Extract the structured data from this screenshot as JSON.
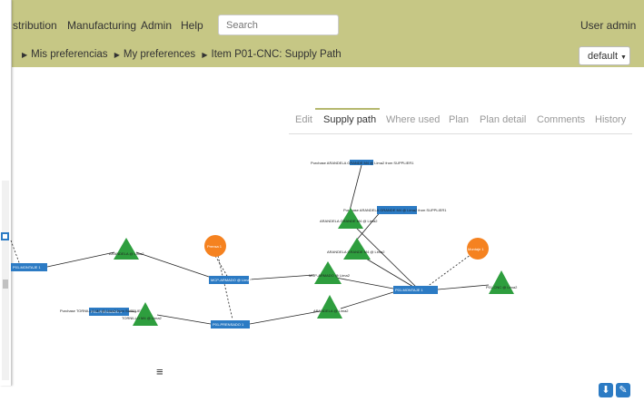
{
  "menu": {
    "distribution": "stribution",
    "manufacturing": "Manufacturing",
    "admin": "Admin",
    "help": "Help",
    "user": "User admin"
  },
  "search": {
    "placeholder": "Search"
  },
  "breadcrumb": {
    "items": [
      "Mis preferencias",
      "My preferences",
      "Item P01-CNC: Supply Path"
    ]
  },
  "scenario": {
    "label": "default"
  },
  "tabs": [
    "Edit",
    "Supply path",
    "Where used",
    "Plan",
    "Plan detail",
    "Comments",
    "History"
  ],
  "active_tab": "Supply path",
  "graph": {
    "colors": {
      "buffer": "#2c7bc4",
      "operation": "#2e9e3e",
      "resource": "#f58220",
      "edge": "#222222"
    },
    "nodes": [
      {
        "label": "Purchase ARANDELA GRANDE M4 @ Lima2 from SUPPLIER1",
        "kind": "buffer"
      },
      {
        "label": "Purchase ARANDELA GRANDE M4 @ Lima2 from SUPPLIER1",
        "kind": "buffer"
      },
      {
        "label": "ARANDELA GRANDE M4 @ Lima2",
        "kind": "operation"
      },
      {
        "label": "ARANDELA GRANDE M4 @ Lima2",
        "kind": "operation"
      },
      {
        "label": "Montaje 1",
        "kind": "resource"
      },
      {
        "label": "Prensa 1",
        "kind": "resource"
      },
      {
        "label": "P01-CNC @ Lima2",
        "kind": "operation"
      },
      {
        "label": "P01-MONTAJE 1",
        "kind": "buffer"
      },
      {
        "label": "MCP-ARMADO @ Lima2",
        "kind": "operation"
      },
      {
        "label": "MCP-ARMADO @ Lima2",
        "kind": "buffer"
      },
      {
        "label": "ARANDELA @ Lima2",
        "kind": "operation"
      },
      {
        "label": "P01-PRENSADO 1",
        "kind": "buffer"
      },
      {
        "label": "P01-MONTAJE 1",
        "kind": "buffer"
      },
      {
        "label": "P01-PRENSADO 1",
        "kind": "buffer"
      },
      {
        "label": "Purchase TORNILLO M4 @ Lima2 from SUPPLIER1",
        "kind": "buffer"
      },
      {
        "label": "TORNILLO M4 @ Lima2",
        "kind": "operation"
      },
      {
        "label": "ARANDELA @ Lima2",
        "kind": "operation"
      }
    ]
  },
  "toolbar": {
    "hamburger": "≡",
    "download_icon": "download-icon",
    "wrench_icon": "wrench-icon"
  }
}
